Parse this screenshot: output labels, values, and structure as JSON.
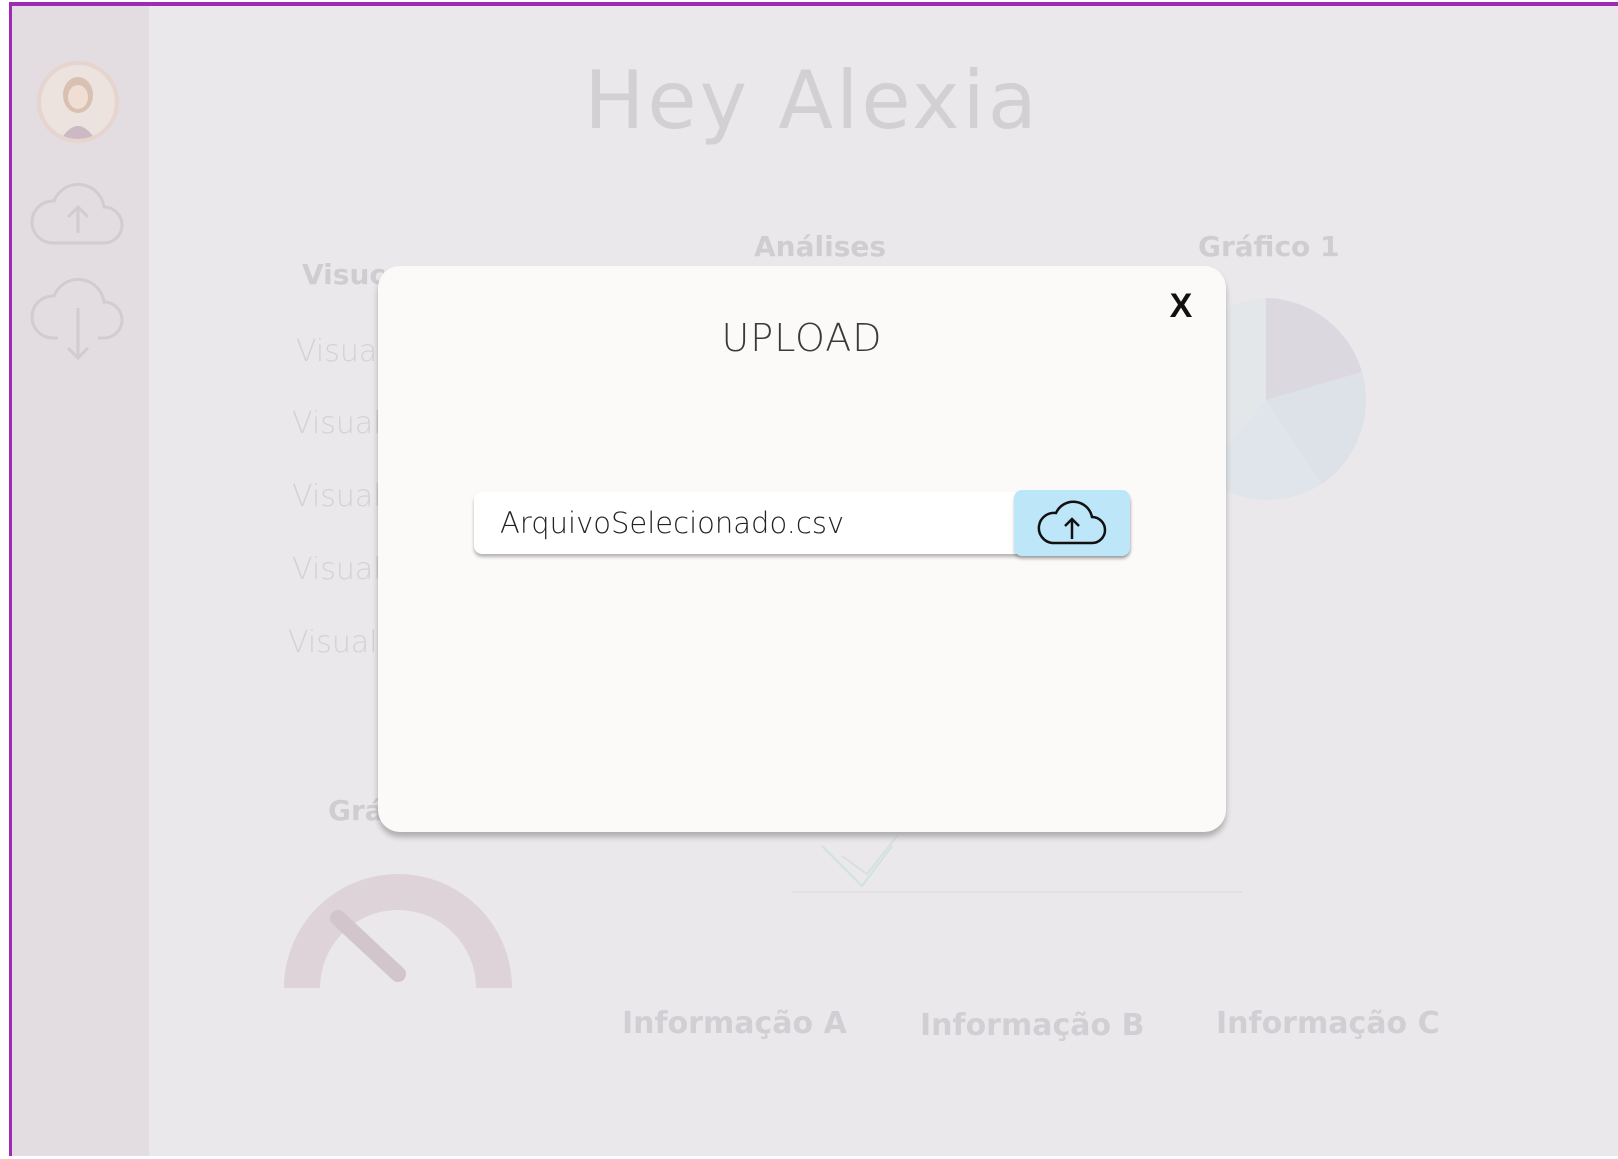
{
  "greeting": "Hey Alexia",
  "sidebar": {
    "items": [
      {
        "icon": "user-avatar"
      },
      {
        "icon": "cloud-upload-icon"
      },
      {
        "icon": "cloud-download-icon"
      }
    ]
  },
  "dashboard": {
    "visualizations_title": "Visuc",
    "vis_items": [
      "Visual",
      "Visual",
      "Visual",
      "Visual",
      "Visuali"
    ],
    "analyses_title": "Análises",
    "chart1_title": "Gráfico 1",
    "gauge_title": "Grá",
    "info": [
      "Informação A",
      "Informação B",
      "Informação C"
    ]
  },
  "modal": {
    "title": "UPLOAD",
    "close_label": "X",
    "file_name": "ArquivoSelecionado.csv",
    "upload_icon": "cloud-upload-icon",
    "button_color": "#bde6f8"
  },
  "colors": {
    "frame_border": "#9d2bb3",
    "sidebar": "#e3dce1",
    "background": "#eae8ea"
  }
}
